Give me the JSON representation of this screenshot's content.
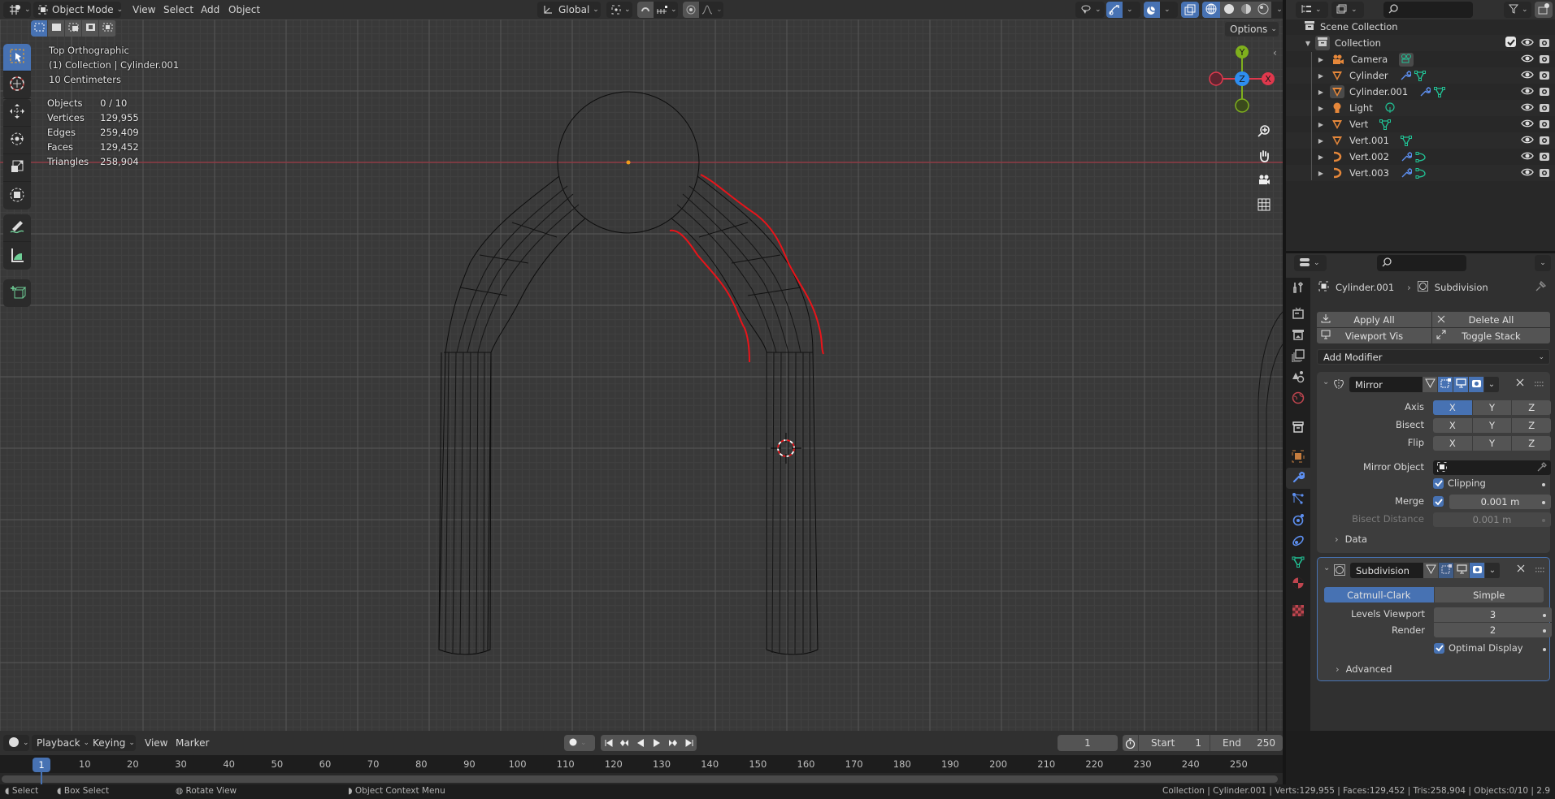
{
  "header": {
    "editor_type_icon": "view3d-editor-icon",
    "mode": "Object Mode",
    "menus": [
      "View",
      "Select",
      "Add",
      "Object"
    ],
    "transform_orientation": "Global",
    "pivot_icon": "pivot-point-icon",
    "snap_icon": "snap-magnet-icon",
    "snap_target_icon": "snap-increment-icon",
    "proportional_icon": "proportional-edit-icon",
    "falloff_icon": "falloff-curve-icon",
    "visibility_icon": "selectability-eye-icon",
    "gizmo_icon": "gizmo-toggle-icon",
    "overlay_icon": "overlay-toggle-icon",
    "xray_icon": "xray-toggle-icon",
    "shading_modes": [
      "wireframe",
      "solid",
      "material-preview",
      "rendered"
    ],
    "active_shading": "wireframe",
    "options_label": "Options"
  },
  "viewport": {
    "view_name": "Top Orthographic",
    "collection_line": "(1) Collection | Cylinder.001",
    "scale_line": "10 Centimeters",
    "stats": [
      {
        "label": "Objects",
        "value": "0 / 10"
      },
      {
        "label": "Vertices",
        "value": "129,955"
      },
      {
        "label": "Edges",
        "value": "259,409"
      },
      {
        "label": "Faces",
        "value": "129,452"
      },
      {
        "label": "Triangles",
        "value": "258,904"
      }
    ],
    "gizmo_axes": {
      "x": "X",
      "y": "Y",
      "z": "Z"
    },
    "axis_colors": {
      "x": "#e0384d",
      "y": "#7fb01d",
      "z": "#2e8ef0"
    },
    "annotation_color": "#e8141a",
    "origin_color": "#f39c1c"
  },
  "toolbar": {
    "tools": [
      "select-box",
      "cursor",
      "move",
      "rotate",
      "scale",
      "transform",
      "annotate",
      "measure",
      "add-cube"
    ],
    "active_tool": "select-box"
  },
  "outliner": {
    "root": "Scene Collection",
    "collection": "Collection",
    "items": [
      {
        "name": "Camera",
        "type": "camera",
        "extras": [
          "camera-data"
        ]
      },
      {
        "name": "Cylinder",
        "type": "mesh",
        "extras": [
          "modifier",
          "mesh-data"
        ]
      },
      {
        "name": "Cylinder.001",
        "type": "mesh",
        "extras": [
          "modifier",
          "mesh-data"
        ],
        "active": true
      },
      {
        "name": "Light",
        "type": "light",
        "extras": [
          "light-data"
        ]
      },
      {
        "name": "Vert",
        "type": "mesh",
        "extras": [
          "mesh-data"
        ]
      },
      {
        "name": "Vert.001",
        "type": "mesh",
        "extras": [
          "mesh-data"
        ]
      },
      {
        "name": "Vert.002",
        "type": "curve",
        "extras": [
          "modifier",
          "curve-data"
        ]
      },
      {
        "name": "Vert.003",
        "type": "curve",
        "extras": [
          "modifier",
          "curve-data"
        ]
      }
    ]
  },
  "properties": {
    "breadcrumb_object": "Cylinder.001",
    "breadcrumb_modifier": "Subdivision",
    "apply_all": "Apply All",
    "delete_all": "Delete All",
    "viewport_vis": "Viewport Vis",
    "toggle_stack": "Toggle Stack",
    "add_modifier": "Add Modifier",
    "mirror": {
      "name": "Mirror",
      "axis_label": "Axis",
      "bisect_label": "Bisect",
      "flip_label": "Flip",
      "axes": [
        "X",
        "Y",
        "Z"
      ],
      "axis_on": [
        true,
        false,
        false
      ],
      "mirror_object_label": "Mirror Object",
      "mirror_object_value": "",
      "clipping_label": "Clipping",
      "clipping": true,
      "merge_label": "Merge",
      "merge_enabled": true,
      "merge_value": "0.001 m",
      "bisect_distance_label": "Bisect Distance",
      "bisect_distance_value": "0.001 m",
      "data_label": "Data"
    },
    "subdivision": {
      "name": "Subdivision",
      "method_options": [
        "Catmull-Clark",
        "Simple"
      ],
      "method_selected": "Catmull-Clark",
      "levels_viewport_label": "Levels Viewport",
      "levels_viewport": "3",
      "render_label": "Render",
      "render": "2",
      "optimal_display_label": "Optimal Display",
      "optimal_display": true,
      "advanced_label": "Advanced"
    }
  },
  "timeline": {
    "menus": [
      "Playback",
      "Keying",
      "View",
      "Marker"
    ],
    "current_frame": "1",
    "start_label": "Start",
    "start": "1",
    "end_label": "End",
    "end": "250",
    "ticks": [
      "10",
      "20",
      "30",
      "40",
      "50",
      "60",
      "70",
      "80",
      "90",
      "100",
      "110",
      "120",
      "130",
      "140",
      "150",
      "160",
      "170",
      "180",
      "190",
      "200",
      "210",
      "220",
      "230",
      "240",
      "250"
    ],
    "playhead": "1"
  },
  "status": {
    "left": [
      "Select",
      "Box Select",
      "Rotate View",
      "Object Context Menu"
    ],
    "right": "Collection | Cylinder.001 | Verts:129,955 | Faces:129,452 | Tris:258,904 | Objects:0/10 | 2.9"
  }
}
